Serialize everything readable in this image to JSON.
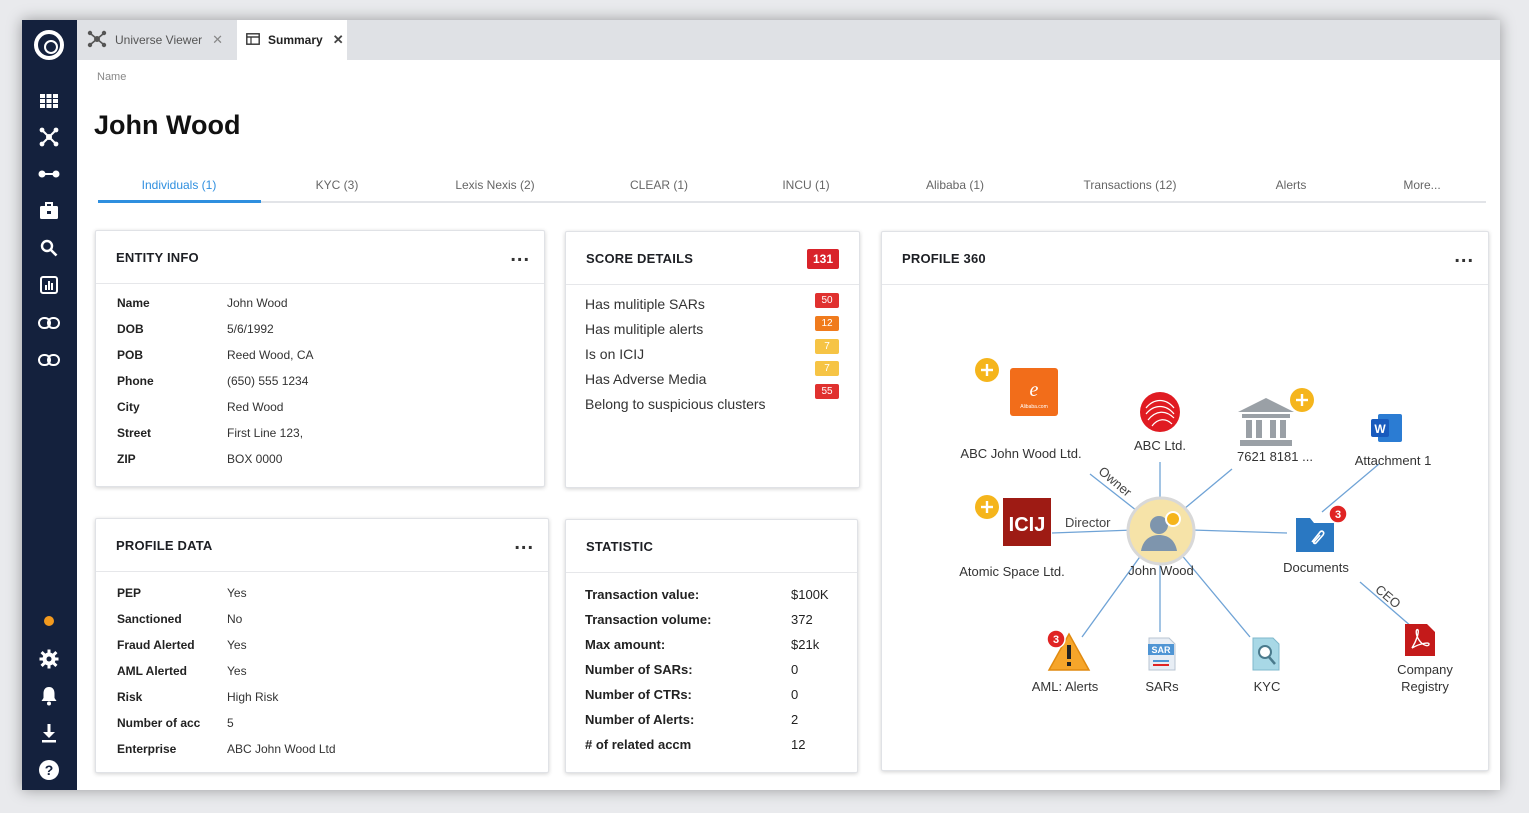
{
  "tabs": [
    {
      "label": "Universe Viewer",
      "icon": "network-icon",
      "active": false
    },
    {
      "label": "Summary",
      "icon": "table-icon",
      "active": true
    }
  ],
  "header": {
    "name_label": "Name",
    "title": "John Wood"
  },
  "section_tabs": [
    "Individuals (1)",
    "KYC (3)",
    "Lexis Nexis (2)",
    "CLEAR (1)",
    "INCU (1)",
    "Alibaba (1)",
    "Transactions (12)",
    "Alerts",
    "More..."
  ],
  "entity_info": {
    "title": "ENTITY INFO",
    "menu": "...",
    "rows": [
      {
        "k": "Name",
        "v": "John Wood"
      },
      {
        "k": "DOB",
        "v": "5/6/1992"
      },
      {
        "k": "POB",
        "v": "Reed Wood, CA"
      },
      {
        "k": "Phone",
        "v": "(650) 555 1234"
      },
      {
        "k": "City",
        "v": "Red Wood"
      },
      {
        "k": "Street",
        "v": "First Line 123,"
      },
      {
        "k": "ZIP",
        "v": "BOX 0000"
      }
    ]
  },
  "score_details": {
    "title": "SCORE DETAILS",
    "total": "131",
    "rows": [
      {
        "label": "Has mulitiple SARs",
        "score": "50",
        "color": "#e0312f"
      },
      {
        "label": "Has mulitiple alerts",
        "score": "12",
        "color": "#f07b1d"
      },
      {
        "label": "Is on ICIJ",
        "score": "7",
        "color": "#f6c445"
      },
      {
        "label": "Has Adverse Media",
        "score": "7",
        "color": "#f6c445"
      },
      {
        "label": "Belong to suspicious clusters",
        "score": "55",
        "color": "#e0312f"
      }
    ]
  },
  "profile_data": {
    "title": "PROFILE DATA",
    "menu": "...",
    "rows": [
      {
        "k": "PEP",
        "v": "Yes"
      },
      {
        "k": "Sanctioned",
        "v": "No"
      },
      {
        "k": "Fraud Alerted",
        "v": "Yes"
      },
      {
        "k": "AML Alerted",
        "v": "Yes"
      },
      {
        "k": "Risk",
        "v": "High Risk"
      },
      {
        "k": "Number of acc",
        "v": "5"
      },
      {
        "k": "Enterprise",
        "v": "ABC John Wood Ltd"
      }
    ]
  },
  "statistic": {
    "title": "STATISTIC",
    "rows": [
      {
        "k": "Transaction value:",
        "v": "$100K"
      },
      {
        "k": "Transaction volume:",
        "v": "372"
      },
      {
        "k": "Max amount:",
        "v": "$21k"
      },
      {
        "k": "Number of SARs:",
        "v": "0"
      },
      {
        "k": "Number of CTRs:",
        "v": "0"
      },
      {
        "k": "Number of Alerts:",
        "v": "2"
      },
      {
        "k": "# of related accm",
        "v": "12"
      }
    ]
  },
  "profile360": {
    "title": "PROFILE 360",
    "menu": "...",
    "center": "John Wood",
    "nodes": {
      "abc_john_wood": "ABC John Wood Ltd.",
      "abc_ltd": "ABC Ltd.",
      "bank": "7621 8181 ...",
      "attachment": "Attachment 1",
      "atomic": "Atomic Space Ltd.",
      "documents": "Documents",
      "aml": "AML: Alerts",
      "sars": "SARs",
      "kyc": "KYC",
      "registry_line1": "Company",
      "registry_line2": "Registry"
    },
    "edge_labels": {
      "owner": "Owner",
      "director": "Director",
      "ceo": "CEO"
    },
    "icon_text": {
      "icij": "ICIJ",
      "sar": "SAR",
      "word": "W",
      "alibaba_sub": "Alibaba.com"
    },
    "badges": {
      "documents": "3",
      "aml": "3"
    },
    "plus": "+",
    "colors": {
      "edge": "#6fa3d6",
      "plus": "#f5b51c",
      "alibaba": "#f26d1a",
      "icij": "#9e1b14",
      "bank": "#9aa0a6",
      "docs": "#2a78c2",
      "pdf": "#c41a1a",
      "badge": "#e02424"
    }
  },
  "sidebar_icons": [
    "grid-icon",
    "network-icon",
    "link-nodes-icon",
    "briefcase-icon",
    "search-icon",
    "bar-chart-icon",
    "link-icon",
    "link-icon",
    "status-dot-icon",
    "settings-icon",
    "bell-icon",
    "download-icon",
    "help-icon"
  ]
}
